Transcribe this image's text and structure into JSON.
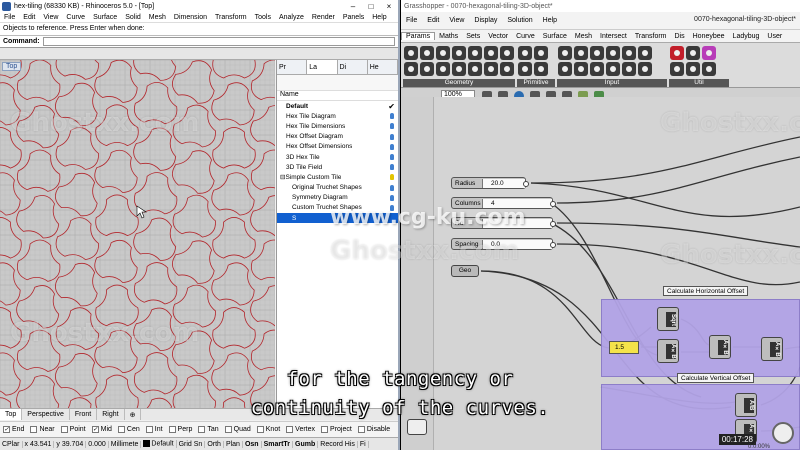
{
  "rhino": {
    "title": "hex-tiling (68330 KB) - Rhinoceros 5.0 - [Top]",
    "menu": [
      "File",
      "Edit",
      "View",
      "Curve",
      "Surface",
      "Solid",
      "Mesh",
      "Dimension",
      "Transform",
      "Tools",
      "Analyze",
      "Render",
      "Panels",
      "Help"
    ],
    "command_history": "Objects to reference. Press Enter when done:",
    "command_label": "Command:",
    "viewport_label": "Top",
    "panel_tabs": [
      "Pr",
      "La",
      "Di",
      "He"
    ],
    "layer_header": "Name",
    "layers": [
      {
        "label": "Default",
        "indent": 1,
        "bold": true,
        "check": true
      },
      {
        "label": "Hex Tile Diagram",
        "indent": 1
      },
      {
        "label": "Hex Tile Dimensions",
        "indent": 1
      },
      {
        "label": "Hex Offset Diagram",
        "indent": 1
      },
      {
        "label": "Hex Offset Dimensions",
        "indent": 1
      },
      {
        "label": "3D Hex Tile",
        "indent": 1
      },
      {
        "label": "3D Tile Field",
        "indent": 1
      },
      {
        "label": "Simple Custom Tile",
        "indent": 0,
        "expander": "⊟"
      },
      {
        "label": "Original Truchet Shapes",
        "indent": 2
      },
      {
        "label": "Symmetry Diagram",
        "indent": 2
      },
      {
        "label": "Custom Truchet Shapes",
        "indent": 2
      },
      {
        "label": "S",
        "indent": 2,
        "selected": true
      }
    ],
    "view_tabs": [
      "Top",
      "Perspective",
      "Front",
      "Right",
      "⊕"
    ],
    "osnaps": [
      {
        "label": "End",
        "checked": true
      },
      {
        "label": "Near",
        "checked": false
      },
      {
        "label": "Point",
        "checked": false
      },
      {
        "label": "Mid",
        "checked": true
      },
      {
        "label": "Cen",
        "checked": false
      },
      {
        "label": "Int",
        "checked": false
      },
      {
        "label": "Perp",
        "checked": false
      },
      {
        "label": "Tan",
        "checked": false
      },
      {
        "label": "Quad",
        "checked": false
      },
      {
        "label": "Knot",
        "checked": false
      },
      {
        "label": "Vertex",
        "checked": false
      },
      {
        "label": "Project",
        "checked": false
      },
      {
        "label": "Disable",
        "checked": false
      }
    ],
    "status": {
      "cplane": "CPlar",
      "x": "x 43.541",
      "y": "y 39.704",
      "z": "0.000",
      "units": "Millimete",
      "layer": "Default",
      "items": [
        "Grid Sn",
        "Orth",
        "Plan",
        "Osn",
        "SmartTr",
        "Gumb",
        "Record His",
        "Fi"
      ]
    }
  },
  "grasshopper": {
    "title": "Grasshopper - 0070-hexagonal-tiling-3D-object*",
    "document_name": "0070-hexagonal-tiling-3D-object*",
    "menu": [
      "File",
      "Edit",
      "View",
      "Display",
      "Solution",
      "Help"
    ],
    "tabs": [
      "Params",
      "Maths",
      "Sets",
      "Vector",
      "Curve",
      "Surface",
      "Mesh",
      "Intersect",
      "Transform",
      "Dis",
      "Honeybee",
      "Ladybug",
      "User"
    ],
    "active_tab": "Params",
    "ribbon_groups": [
      "Geometry",
      "Primitive",
      "Input",
      "Util"
    ],
    "zoom": "100%",
    "sliders": [
      {
        "name": "Radius",
        "value": "20.0"
      },
      {
        "name": "Columns",
        "value": "4"
      },
      {
        "name": "Ro",
        "value": ""
      },
      {
        "name": "Spacing",
        "value": "0.0"
      }
    ],
    "geo_label": "Geo",
    "group_labels": [
      "Calculate Horizontal Offset",
      "Calculate Vertical Offset"
    ],
    "panel_value": "1.5",
    "node_labels": [
      "Sqrt",
      "A×B",
      "A×B",
      "A×B",
      "A/B",
      "A×B"
    ],
    "timestamp": "00:17:28",
    "time_sub": "0:0:00%"
  },
  "subtitles": [
    "for the tangency or",
    "continuity of the curves."
  ],
  "watermarks": [
    "Ghostxx.com",
    "www.cg-ku.com"
  ],
  "colors": {
    "curve_red": "#b3262c",
    "selection_blue": "#1160d0",
    "group_purple": "#b2a3e6",
    "panel_yellow": "#f4e34a"
  }
}
